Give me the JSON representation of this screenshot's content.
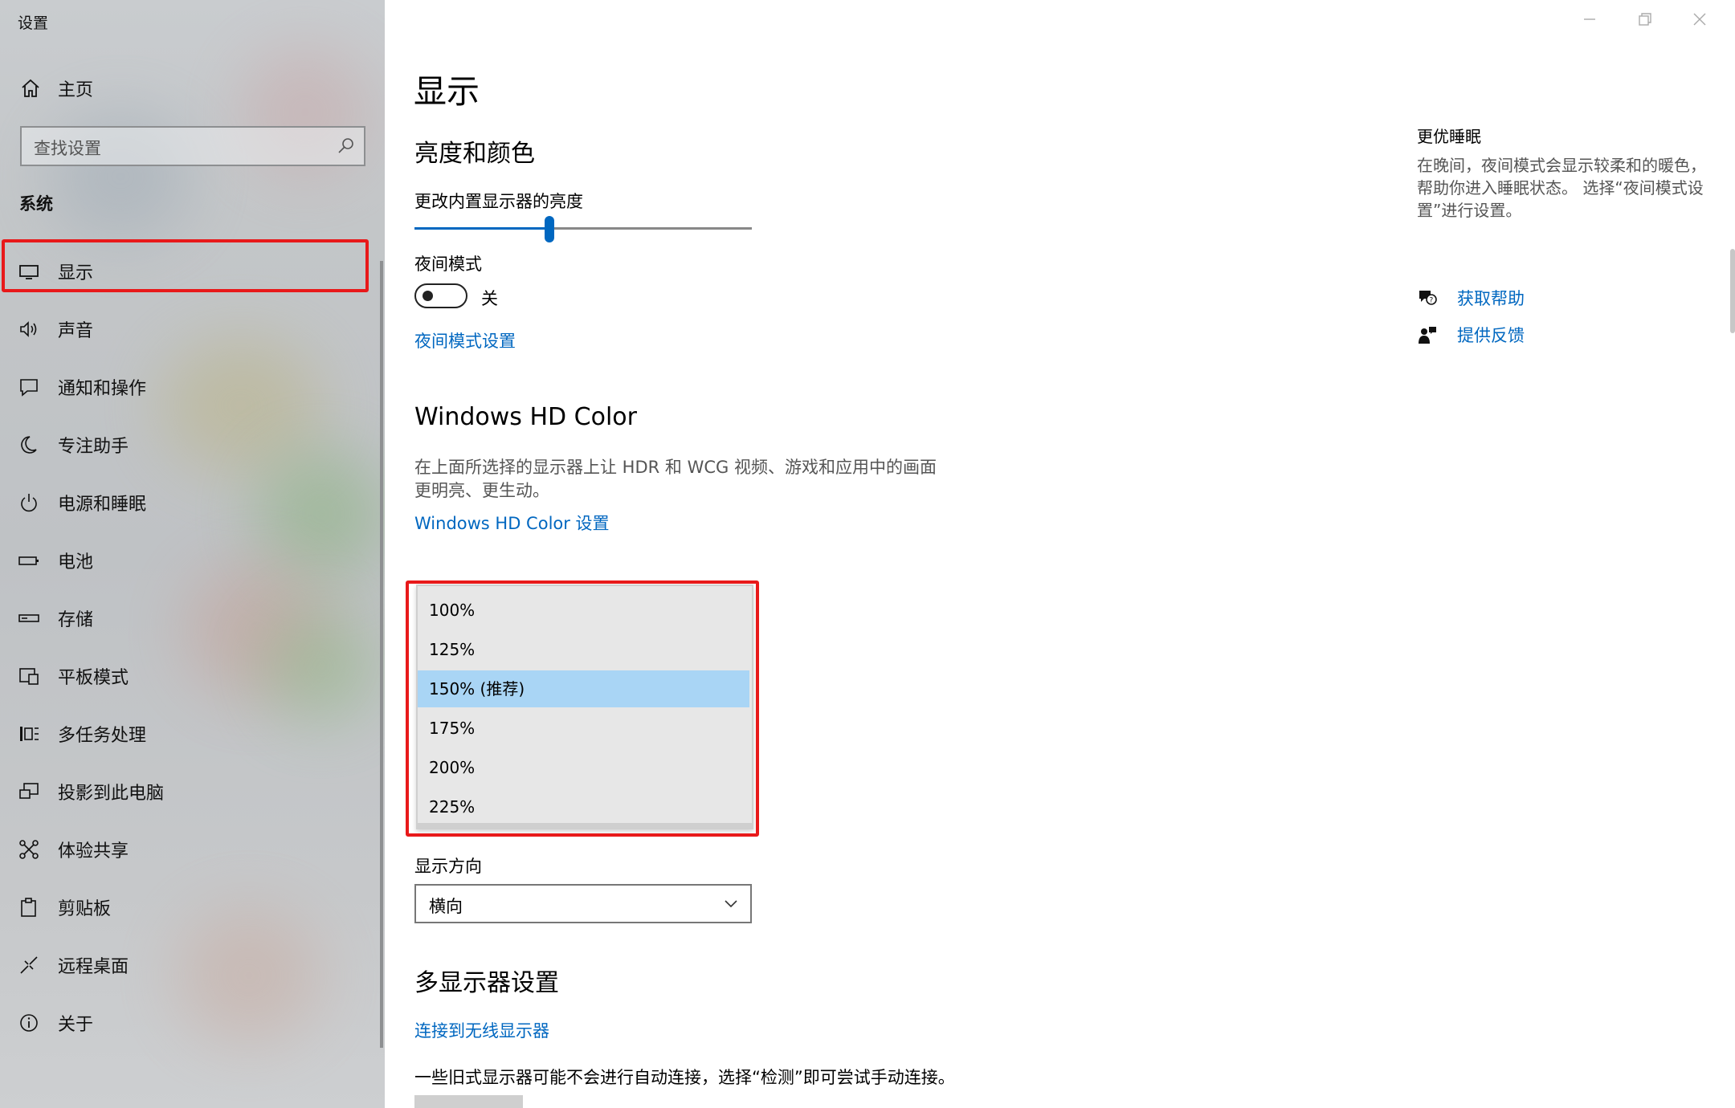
{
  "window": {
    "title": "设置"
  },
  "sidebar": {
    "home_label": "主页",
    "search_placeholder": "查找设置",
    "group_label": "系统",
    "items": [
      {
        "label": "显示",
        "icon": "monitor-icon",
        "selected": true
      },
      {
        "label": "声音",
        "icon": "speaker-icon"
      },
      {
        "label": "通知和操作",
        "icon": "notification-icon"
      },
      {
        "label": "专注助手",
        "icon": "moon-icon"
      },
      {
        "label": "电源和睡眠",
        "icon": "power-icon"
      },
      {
        "label": "电池",
        "icon": "battery-icon"
      },
      {
        "label": "存储",
        "icon": "storage-icon"
      },
      {
        "label": "平板模式",
        "icon": "tablet-icon"
      },
      {
        "label": "多任务处理",
        "icon": "multitask-icon"
      },
      {
        "label": "投影到此电脑",
        "icon": "project-icon"
      },
      {
        "label": "体验共享",
        "icon": "share-icon"
      },
      {
        "label": "剪贴板",
        "icon": "clipboard-icon"
      },
      {
        "label": "远程桌面",
        "icon": "remote-desktop-icon"
      },
      {
        "label": "关于",
        "icon": "info-icon"
      }
    ]
  },
  "main": {
    "title": "显示",
    "brightness": {
      "heading": "亮度和颜色",
      "slider_label": "更改内置显示器的亮度",
      "slider_value": 0.4
    },
    "night_mode": {
      "label": "夜间模式",
      "state": "关",
      "settings_link": "夜间模式设置"
    },
    "hd_color": {
      "heading": "Windows HD Color",
      "description": "在上面所选择的显示器上让 HDR 和 WCG 视频、游戏和应用中的画面更明亮、更生动。",
      "link": "Windows HD Color 设置"
    },
    "scale_dropdown": {
      "options": [
        "100%",
        "125%",
        "150% (推荐)",
        "175%",
        "200%",
        "225%"
      ],
      "selected": "150% (推荐)"
    },
    "orientation": {
      "label": "显示方向",
      "value": "横向"
    },
    "multi_display": {
      "heading": "多显示器设置",
      "link": "连接到无线显示器",
      "description": "一些旧式显示器可能不会进行自动连接，选择“检测”即可尝试手动连接。"
    }
  },
  "right_panel": {
    "heading": "更优睡眠",
    "description": "在晚间，夜间模式会显示较柔和的暖色，帮助你进入睡眠状态。 选择“夜间模式设置”进行设置。",
    "help_link": "获取帮助",
    "feedback_link": "提供反馈"
  },
  "colors": {
    "accent": "#0067c0",
    "highlight_box": "#e8191a",
    "selected_option": "#a9d5f5"
  }
}
